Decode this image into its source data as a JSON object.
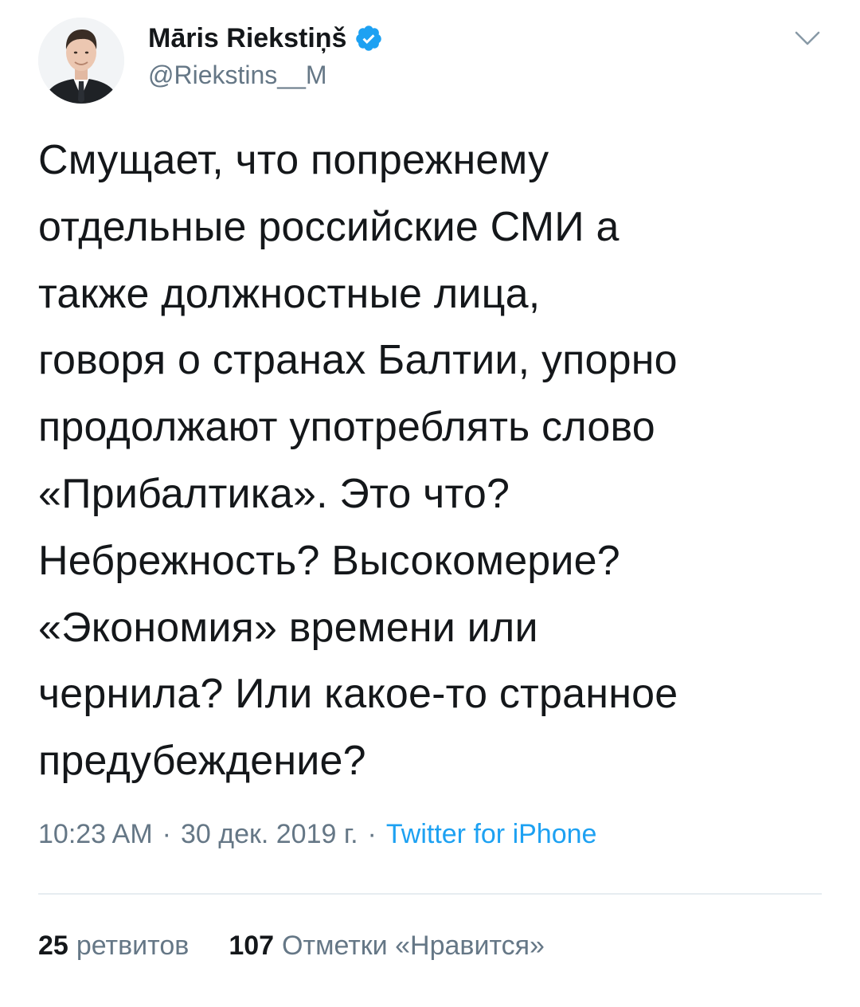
{
  "author": {
    "display_name": "Māris Riekstiņš",
    "handle": "@Riekstins__M",
    "verified": true
  },
  "tweet": {
    "text": "Смущает, что попрежнему\nотдельные российские СМИ а\nтакже должностные лица,\nговоря о странах Балтии, упорно\nпродолжают употреблять слово\n«Прибалтика». Это что?\nНебрежность? Высокомерие?\n«Экономия» времени или\nчернила? Или какое-то странное\nпредубеждение?",
    "time": "10:23 AM",
    "separator": "·",
    "date": "30 дек. 2019 г.",
    "source": "Twitter for iPhone"
  },
  "stats": {
    "retweets_count": "25",
    "retweets_label": "ретвитов",
    "likes_count": "107",
    "likes_label": "Отметки «Нравится»"
  },
  "icons": {
    "verified": "verified-badge-icon",
    "menu": "chevron-down-icon"
  },
  "colors": {
    "text": "#14171a",
    "secondary": "#657786",
    "accent": "#1da1f2",
    "divider": "#e6ecf0"
  }
}
